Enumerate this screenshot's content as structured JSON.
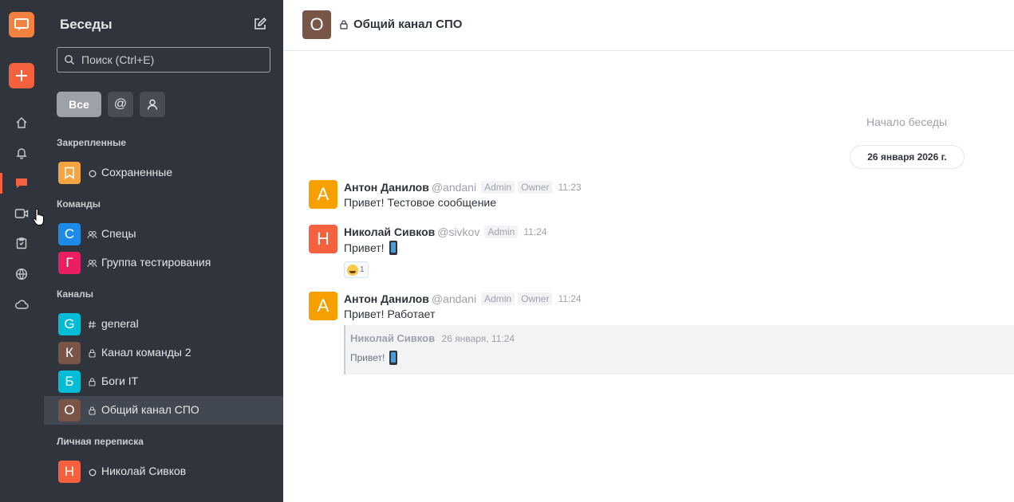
{
  "colors": {
    "rail_bg": "#2f343d",
    "accent": "#f5613f",
    "active_icon": "#f5613f"
  },
  "rail": {
    "icons": [
      "app-logo-icon",
      "create-new-icon",
      "home-icon",
      "bell-icon",
      "chat-icon",
      "video-icon",
      "clipboard-icon",
      "globe-icon",
      "cloud-icon"
    ]
  },
  "sidebar": {
    "title": "Беседы",
    "search_placeholder": "Поиск (Ctrl+E)",
    "filter_all": "Все",
    "filter_mentions": "@",
    "sections": {
      "pinned": "Закрепленные",
      "teams": "Команды",
      "channels": "Каналы",
      "direct": "Личная переписка"
    },
    "items": [
      {
        "label": "Сохраненные",
        "letter": "",
        "color": "#f5a442",
        "type": "status"
      },
      {
        "label": "Спецы",
        "letter": "С",
        "color": "#1d8ae8",
        "type": "team"
      },
      {
        "label": "Группа тестирования",
        "letter": "Г",
        "color": "#e91e63",
        "type": "team"
      },
      {
        "label": "general",
        "letter": "G",
        "color": "#00bcd4",
        "type": "hash"
      },
      {
        "label": "Канал команды 2",
        "letter": "К",
        "color": "#795548",
        "type": "lock"
      },
      {
        "label": "Боги IT",
        "letter": "Б",
        "color": "#00bcd4",
        "type": "lock"
      },
      {
        "label": "Общий канал СПО",
        "letter": "О",
        "color": "#795548",
        "type": "lock",
        "active": true
      },
      {
        "label": "Николай Сивков",
        "letter": "Н",
        "color": "#f5613f",
        "type": "status"
      }
    ]
  },
  "header": {
    "avatar_letter": "О",
    "title": "Общий канал СПО"
  },
  "chat": {
    "start_label": "Начало беседы",
    "date_label": "26 января 2026 г.",
    "messages": [
      {
        "avatar": "А",
        "color": "#f5a000",
        "name": "Антон Данилов",
        "username": "@andani",
        "badges": [
          "Admin",
          "Owner"
        ],
        "time": "11:23",
        "text": "Привет! Тестовое сообщение"
      },
      {
        "avatar": "Н",
        "color": "#f5613f",
        "name": "Николай Сивков",
        "username": "@sivkov",
        "badges": [
          "Admin"
        ],
        "time": "11:24",
        "text": "Привет!",
        "reaction_count": "1"
      },
      {
        "avatar": "А",
        "color": "#f5a000",
        "name": "Антон Данилов",
        "username": "@andani",
        "badges": [
          "Admin",
          "Owner"
        ],
        "time": "11:24",
        "text": "Привет! Работает",
        "quote": {
          "name": "Николай Сивков",
          "time": "26 января, 11:24",
          "text": "Привет!"
        }
      }
    ]
  }
}
